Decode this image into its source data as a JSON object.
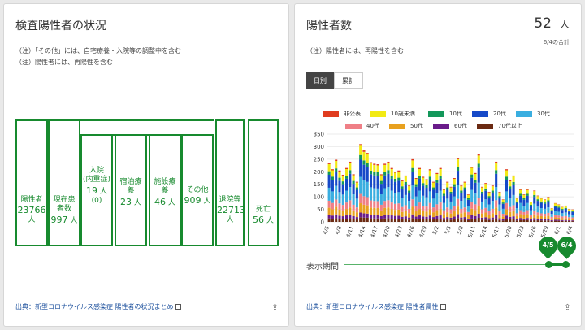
{
  "left_card": {
    "title": "検査陽性者の状況",
    "notes": [
      "（注）「その他」には、自宅療養・入院等の調整中を含む",
      "（注）陽性者には、再陽性を含む"
    ],
    "boxes": {
      "positive": {
        "label": "陽性者",
        "value": "23766",
        "unit": "人"
      },
      "current": {
        "label1": "現在患",
        "label2": "者数",
        "value": "997",
        "unit": "人"
      },
      "hospital": {
        "label1": "入院",
        "label2": "(内重症)",
        "value": "19",
        "unit": "人",
        "sub": "(0)"
      },
      "hotel": {
        "label1": "宿泊療",
        "label2": "養",
        "value": "23",
        "unit": "人"
      },
      "facility": {
        "label1": "施設療",
        "label2": "養",
        "value": "46",
        "unit": "人"
      },
      "other": {
        "label": "その他",
        "value": "909",
        "unit": "人"
      },
      "discharged": {
        "label": "退院等",
        "value": "22713",
        "unit": "人"
      },
      "death": {
        "label": "死亡",
        "value": "56",
        "unit": "人"
      }
    },
    "source": "出典：新型コロナウイルス感染症 陽性者の状況まとめ",
    "share_icon": "share-icon"
  },
  "right_card": {
    "title": "陽性者数",
    "count": "52",
    "count_unit": "人",
    "count_note": "6/4の合計",
    "notes": [
      "（注）陽性者には、再陽性を含む"
    ],
    "tabs": [
      "日別",
      "累計"
    ],
    "source": "出典：新型コロナウイルス感染症 陽性者属性",
    "period_label": "表示期間",
    "range_start": "4/5",
    "range_end": "6/4",
    "share_icon": "share-icon"
  },
  "chart_data": {
    "type": "bar",
    "stacked": true,
    "ylim": [
      0,
      350
    ],
    "yticks": [
      0,
      50,
      100,
      150,
      200,
      250,
      300,
      350
    ],
    "xticks": [
      "4/5",
      "4/8",
      "4/11",
      "4/14",
      "4/17",
      "4/20",
      "4/23",
      "4/26",
      "4/29",
      "5/2",
      "5/5",
      "5/8",
      "5/11",
      "5/14",
      "5/17",
      "5/20",
      "5/23",
      "5/26",
      "5/29",
      "6/1",
      "6/4"
    ],
    "legend": [
      "非公表",
      "10歳未満",
      "10代",
      "20代",
      "30代",
      "40代",
      "50代",
      "60代",
      "70代以上"
    ],
    "colors": [
      "#e03c1f",
      "#f2ea14",
      "#13975a",
      "#1649c8",
      "#3aaee0",
      "#ef7f86",
      "#e8a11f",
      "#6a1b8a",
      "#6b2a12"
    ],
    "totals": [
      235,
      210,
      248,
      205,
      188,
      215,
      240,
      190,
      160,
      310,
      285,
      275,
      238,
      232,
      230,
      190,
      232,
      240,
      215,
      200,
      205,
      165,
      185,
      145,
      250,
      175,
      215,
      180,
      170,
      210,
      160,
      195,
      215,
      130,
      160,
      140,
      175,
      255,
      145,
      160,
      110,
      220,
      195,
      270,
      140,
      155,
      120,
      145,
      240,
      120,
      90,
      210,
      165,
      185,
      95,
      130,
      110,
      130,
      80,
      125,
      105,
      95,
      90,
      100,
      55,
      75,
      70,
      60,
      65,
      52,
      50
    ],
    "shares": [
      0.02,
      0.12,
      0.06,
      0.22,
      0.22,
      0.12,
      0.12,
      0.06,
      0.06
    ]
  }
}
